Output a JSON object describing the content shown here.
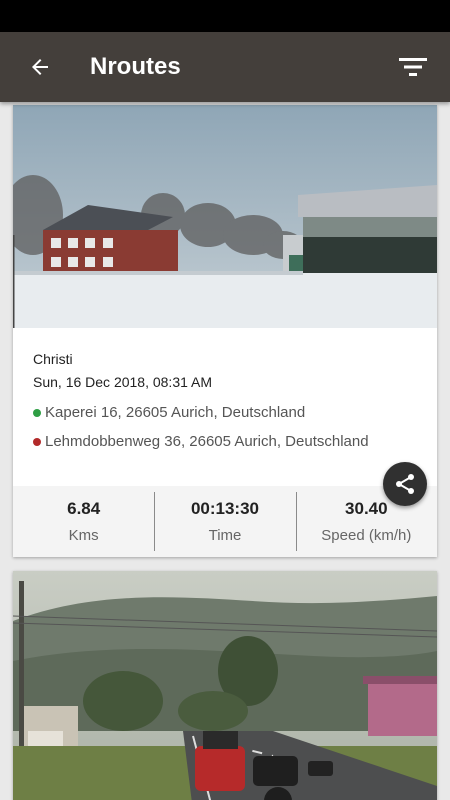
{
  "app_bar": {
    "title": "Nroutes",
    "back_icon": "arrow-left-icon",
    "filter_icon": "filter-icon",
    "background": "#443f3b"
  },
  "routes": [
    {
      "name": "Christi",
      "date": "Sun, 16 Dec 2018, 08:31 AM",
      "start_location": "Kaperei 16, 26605 Aurich, Deutschland",
      "end_location": "Lehmdobbenweg 36, 26605 Aurich, Deutschland",
      "start_color": "#2e9e44",
      "end_color": "#b22a2a",
      "share_icon": "share-icon",
      "stats": {
        "distance_value": "6.84",
        "distance_label": "Kms",
        "time_value": "00:13:30",
        "time_label": "Time",
        "speed_value": "30.40",
        "speed_label": "Speed (km/h)"
      }
    }
  ]
}
